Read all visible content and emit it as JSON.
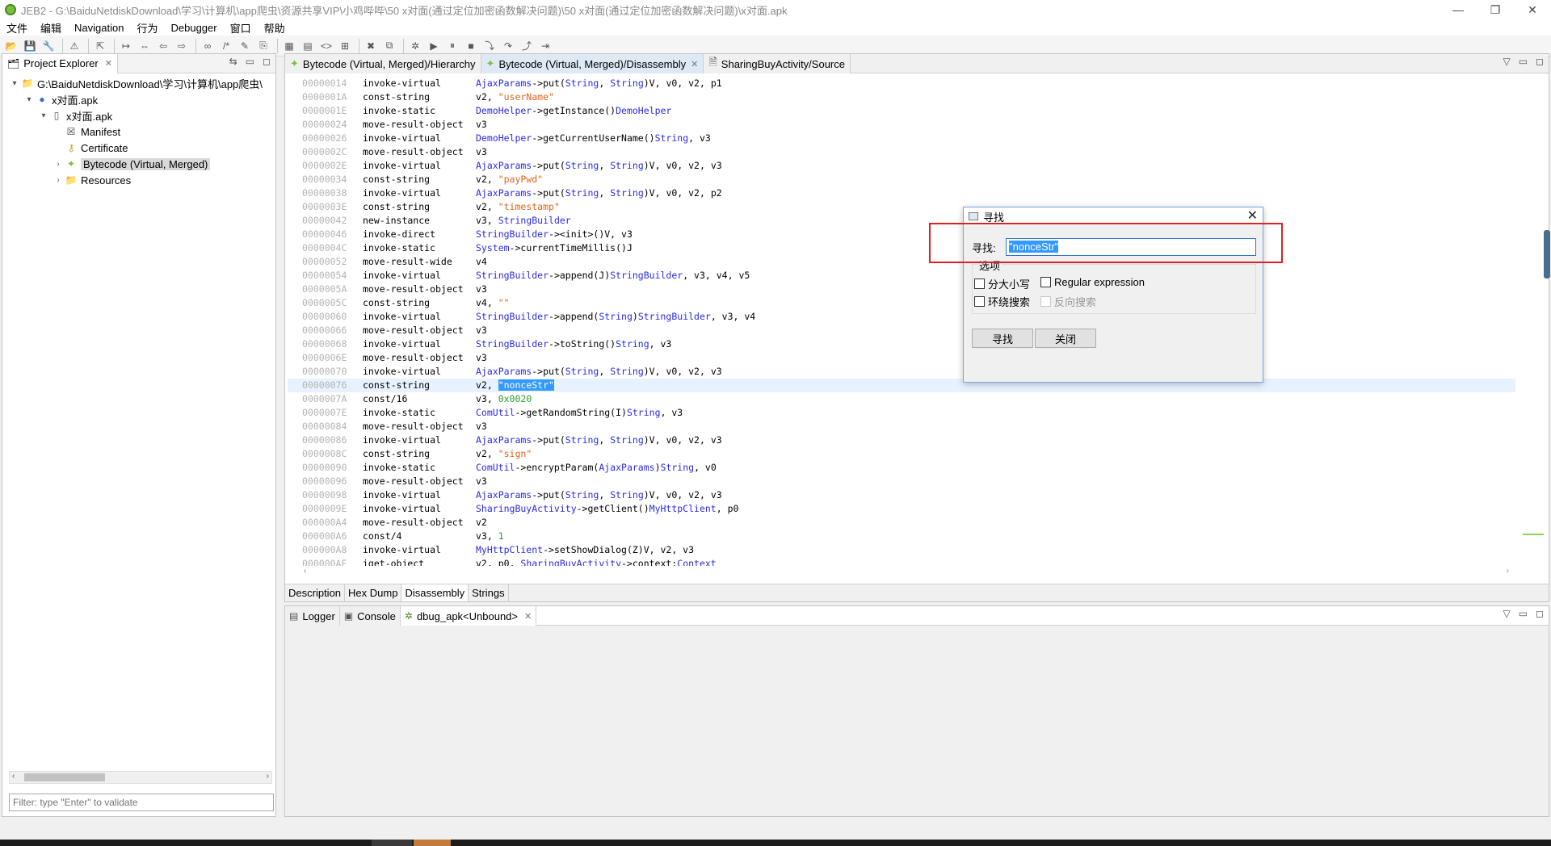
{
  "window": {
    "title": "JEB2 - G:\\BaiduNetdiskDownload\\学习\\计算机\\app爬虫\\资源共享VIP\\小鸡哔哔\\50 x对面(通过定位加密函数解决问题)\\50 x对面(通过定位加密函数解决问题)\\x对面.apk",
    "minimize": "—",
    "restore": "❐",
    "close": "✕"
  },
  "menu": [
    "文件",
    "编辑",
    "Navigation",
    "行为",
    "Debugger",
    "窗口",
    "帮助"
  ],
  "explorer": {
    "tab_label": "Project Explorer",
    "tree": [
      {
        "label": "G:\\BaiduNetdiskDownload\\学习\\计算机\\app爬虫\\",
        "icon": "folder-icon",
        "level": 0,
        "twisty": "▾"
      },
      {
        "label": "x对面.apk",
        "icon": "project-icon",
        "level": 1,
        "twisty": "▾"
      },
      {
        "label": "x对面.apk",
        "icon": "apk-icon",
        "level": 2,
        "twisty": "▾"
      },
      {
        "label": "Manifest",
        "icon": "manifest-icon",
        "level": 3,
        "twisty": ""
      },
      {
        "label": "Certificate",
        "icon": "key-icon",
        "level": 3,
        "twisty": ""
      },
      {
        "label": "Bytecode (Virtual, Merged)",
        "icon": "android-icon",
        "level": 3,
        "twisty": "›"
      },
      {
        "label": "Resources",
        "icon": "folder-icon",
        "level": 3,
        "twisty": "›"
      }
    ],
    "filter_placeholder": "Filter: type \"Enter\" to validate"
  },
  "editor": {
    "tabs": [
      {
        "label": "Bytecode (Virtual, Merged)/Hierarchy",
        "active": false,
        "closable": false
      },
      {
        "label": "Bytecode (Virtual, Merged)/Disassembly",
        "active": true,
        "closable": true
      },
      {
        "label": "SharingBuyActivity/Source",
        "active": false,
        "closable": false
      }
    ],
    "bottom_tabs": [
      "Description",
      "Hex Dump",
      "Disassembly",
      "Strings"
    ],
    "active_bottom_tab": "Disassembly",
    "lines": [
      {
        "addr": "00000014",
        "op": "invoke-virtual",
        "args": [
          [
            "c",
            "AjaxParams"
          ],
          [
            "t",
            "->put("
          ],
          [
            "c",
            "String"
          ],
          [
            "t",
            ", "
          ],
          [
            "c",
            "String"
          ],
          [
            "t",
            ")V, v0, v2, p1"
          ]
        ]
      },
      {
        "addr": "0000001A",
        "op": "const-string",
        "args": [
          [
            "t",
            "v2, "
          ],
          [
            "s",
            "\"userName\""
          ]
        ]
      },
      {
        "addr": "0000001E",
        "op": "invoke-static",
        "args": [
          [
            "c",
            "DemoHelper"
          ],
          [
            "t",
            "->getInstance()"
          ],
          [
            "c",
            "DemoHelper"
          ]
        ]
      },
      {
        "addr": "00000024",
        "op": "move-result-object",
        "args": [
          [
            "t",
            "v3"
          ]
        ]
      },
      {
        "addr": "00000026",
        "op": "invoke-virtual",
        "args": [
          [
            "c",
            "DemoHelper"
          ],
          [
            "t",
            "->getCurrentUserName()"
          ],
          [
            "c",
            "String"
          ],
          [
            "t",
            ", v3"
          ]
        ]
      },
      {
        "addr": "0000002C",
        "op": "move-result-object",
        "args": [
          [
            "t",
            "v3"
          ]
        ]
      },
      {
        "addr": "0000002E",
        "op": "invoke-virtual",
        "args": [
          [
            "c",
            "AjaxParams"
          ],
          [
            "t",
            "->put("
          ],
          [
            "c",
            "String"
          ],
          [
            "t",
            ", "
          ],
          [
            "c",
            "String"
          ],
          [
            "t",
            ")V, v0, v2, v3"
          ]
        ]
      },
      {
        "addr": "00000034",
        "op": "const-string",
        "args": [
          [
            "t",
            "v2, "
          ],
          [
            "s",
            "\"payPwd\""
          ]
        ]
      },
      {
        "addr": "00000038",
        "op": "invoke-virtual",
        "args": [
          [
            "c",
            "AjaxParams"
          ],
          [
            "t",
            "->put("
          ],
          [
            "c",
            "String"
          ],
          [
            "t",
            ", "
          ],
          [
            "c",
            "String"
          ],
          [
            "t",
            ")V, v0, v2, p2"
          ]
        ]
      },
      {
        "addr": "0000003E",
        "op": "const-string",
        "args": [
          [
            "t",
            "v2, "
          ],
          [
            "s",
            "\"timestamp\""
          ]
        ]
      },
      {
        "addr": "00000042",
        "op": "new-instance",
        "args": [
          [
            "t",
            "v3, "
          ],
          [
            "c",
            "StringBuilder"
          ]
        ]
      },
      {
        "addr": "00000046",
        "op": "invoke-direct",
        "args": [
          [
            "c",
            "StringBuilder"
          ],
          [
            "t",
            "-><init>()V, v3"
          ]
        ]
      },
      {
        "addr": "0000004C",
        "op": "invoke-static",
        "args": [
          [
            "c",
            "System"
          ],
          [
            "t",
            "->currentTimeMillis()J"
          ]
        ]
      },
      {
        "addr": "00000052",
        "op": "move-result-wide",
        "args": [
          [
            "t",
            "v4"
          ]
        ]
      },
      {
        "addr": "00000054",
        "op": "invoke-virtual",
        "args": [
          [
            "c",
            "StringBuilder"
          ],
          [
            "t",
            "->append(J)"
          ],
          [
            "c",
            "StringBuilder"
          ],
          [
            "t",
            ", v3, v4, v5"
          ]
        ]
      },
      {
        "addr": "0000005A",
        "op": "move-result-object",
        "args": [
          [
            "t",
            "v3"
          ]
        ]
      },
      {
        "addr": "0000005C",
        "op": "const-string",
        "args": [
          [
            "t",
            "v4, "
          ],
          [
            "s",
            "\"\""
          ]
        ]
      },
      {
        "addr": "00000060",
        "op": "invoke-virtual",
        "args": [
          [
            "c",
            "StringBuilder"
          ],
          [
            "t",
            "->append("
          ],
          [
            "c",
            "String"
          ],
          [
            "t",
            ")"
          ],
          [
            "c",
            "StringBuilder"
          ],
          [
            "t",
            ", v3, v4"
          ]
        ]
      },
      {
        "addr": "00000066",
        "op": "move-result-object",
        "args": [
          [
            "t",
            "v3"
          ]
        ]
      },
      {
        "addr": "00000068",
        "op": "invoke-virtual",
        "args": [
          [
            "c",
            "StringBuilder"
          ],
          [
            "t",
            "->toString()"
          ],
          [
            "c",
            "String"
          ],
          [
            "t",
            ", v3"
          ]
        ]
      },
      {
        "addr": "0000006E",
        "op": "move-result-object",
        "args": [
          [
            "t",
            "v3"
          ]
        ]
      },
      {
        "addr": "00000070",
        "op": "invoke-virtual",
        "args": [
          [
            "c",
            "AjaxParams"
          ],
          [
            "t",
            "->put("
          ],
          [
            "c",
            "String"
          ],
          [
            "t",
            ", "
          ],
          [
            "c",
            "String"
          ],
          [
            "t",
            ")V, v0, v2, v3"
          ]
        ]
      },
      {
        "addr": "00000076",
        "op": "const-string",
        "current": true,
        "args": [
          [
            "t",
            "v2, "
          ],
          [
            "x",
            "\"nonceStr\""
          ]
        ]
      },
      {
        "addr": "0000007A",
        "op": "const/16",
        "args": [
          [
            "t",
            "v3, "
          ],
          [
            "n",
            "0x0020"
          ]
        ]
      },
      {
        "addr": "0000007E",
        "op": "invoke-static",
        "args": [
          [
            "c",
            "ComUtil"
          ],
          [
            "t",
            "->getRandomString(I)"
          ],
          [
            "c",
            "String"
          ],
          [
            "t",
            ", v3"
          ]
        ]
      },
      {
        "addr": "00000084",
        "op": "move-result-object",
        "args": [
          [
            "t",
            "v3"
          ]
        ]
      },
      {
        "addr": "00000086",
        "op": "invoke-virtual",
        "args": [
          [
            "c",
            "AjaxParams"
          ],
          [
            "t",
            "->put("
          ],
          [
            "c",
            "String"
          ],
          [
            "t",
            ", "
          ],
          [
            "c",
            "String"
          ],
          [
            "t",
            ")V, v0, v2, v3"
          ]
        ]
      },
      {
        "addr": "0000008C",
        "op": "const-string",
        "args": [
          [
            "t",
            "v2, "
          ],
          [
            "s",
            "\"sign\""
          ]
        ]
      },
      {
        "addr": "00000090",
        "op": "invoke-static",
        "args": [
          [
            "c",
            "ComUtil"
          ],
          [
            "t",
            "->encryptParam("
          ],
          [
            "c",
            "AjaxParams"
          ],
          [
            "t",
            ")"
          ],
          [
            "c",
            "String"
          ],
          [
            "t",
            ", v0"
          ]
        ]
      },
      {
        "addr": "00000096",
        "op": "move-result-object",
        "args": [
          [
            "t",
            "v3"
          ]
        ]
      },
      {
        "addr": "00000098",
        "op": "invoke-virtual",
        "args": [
          [
            "c",
            "AjaxParams"
          ],
          [
            "t",
            "->put("
          ],
          [
            "c",
            "String"
          ],
          [
            "t",
            ", "
          ],
          [
            "c",
            "String"
          ],
          [
            "t",
            ")V, v0, v2, v3"
          ]
        ]
      },
      {
        "addr": "0000009E",
        "op": "invoke-virtual",
        "args": [
          [
            "c",
            "SharingBuyActivity"
          ],
          [
            "t",
            "->getClient()"
          ],
          [
            "c",
            "MyHttpClient"
          ],
          [
            "t",
            ", p0"
          ]
        ]
      },
      {
        "addr": "000000A4",
        "op": "move-result-object",
        "args": [
          [
            "t",
            "v2"
          ]
        ]
      },
      {
        "addr": "000000A6",
        "op": "const/4",
        "args": [
          [
            "t",
            "v3, "
          ],
          [
            "n",
            "1"
          ]
        ]
      },
      {
        "addr": "000000A8",
        "op": "invoke-virtual",
        "args": [
          [
            "c",
            "MyHttpClient"
          ],
          [
            "t",
            "->setShowDialog(Z)V, v2, v3"
          ]
        ]
      },
      {
        "addr": "000000AE",
        "op": "iget-object",
        "args": [
          [
            "t",
            "v2, p0, "
          ],
          [
            "c",
            "SharingBuyActivity"
          ],
          [
            "t",
            "->context:"
          ],
          [
            "c",
            "Context"
          ]
        ]
      }
    ]
  },
  "console": {
    "tabs": [
      {
        "label": "Logger",
        "icon": "logger-icon",
        "active": false,
        "closable": false
      },
      {
        "label": "Console",
        "icon": "console-icon",
        "active": false,
        "closable": false
      },
      {
        "label": "dbug_apk<Unbound>",
        "icon": "debug-icon",
        "active": true,
        "closable": true
      }
    ]
  },
  "find_dialog": {
    "title": "寻找",
    "find_label": "寻找:",
    "find_value": "\"nonceStr\"",
    "options_label": "选项",
    "opt_case": "分大小写",
    "opt_regex": "Regular expression",
    "opt_wrap": "环绕搜索",
    "opt_reverse": "反向搜索",
    "find_button": "寻找",
    "close_button": "关闭"
  },
  "colors": {
    "class": "#2a2ae6",
    "string": "#e2631b",
    "number": "#2d9b2d",
    "selection": "#3399ff",
    "highlight_box": "#e02020"
  }
}
